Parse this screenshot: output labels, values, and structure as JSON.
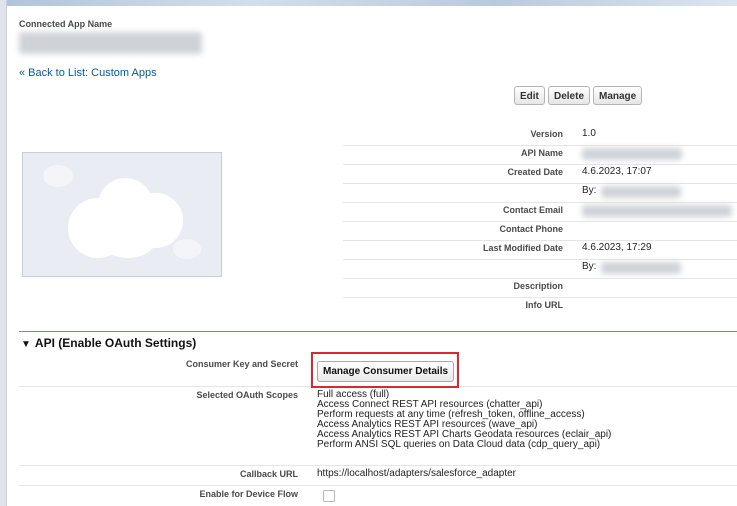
{
  "header": {
    "app_name_label": "Connected App Name",
    "back_link": "« Back to List: Custom Apps"
  },
  "toolbar": {
    "edit_label": "Edit",
    "delete_label": "Delete",
    "manage_label": "Manage"
  },
  "details": {
    "version_label": "Version",
    "version_value": "1.0",
    "api_name_label": "API Name",
    "created_date_label": "Created Date",
    "created_date_value": "4.6.2023, 17:07",
    "created_by_prefix": "By:",
    "contact_email_label": "Contact Email",
    "contact_phone_label": "Contact Phone",
    "last_modified_label": "Last Modified Date",
    "last_modified_value": "4.6.2023, 17:29",
    "modified_by_prefix": "By:",
    "description_label": "Description",
    "info_url_label": "Info URL"
  },
  "api_section": {
    "title": "API (Enable OAuth Settings)",
    "consumer_key_label": "Consumer Key and Secret",
    "manage_consumer_button": "Manage Consumer Details",
    "scopes_label": "Selected OAuth Scopes",
    "scopes": [
      "Full access (full)",
      "Access Connect REST API resources (chatter_api)",
      "Perform requests at any time (refresh_token, offline_access)",
      "Access Analytics REST API resources (wave_api)",
      "Access Analytics REST API Charts Geodata resources (eclair_api)",
      "Perform ANSI SQL queries on Data Cloud data (cdp_query_api)"
    ],
    "callback_url_label": "Callback URL",
    "callback_url_value": "https://localhost/adapters/salesforce_adapter",
    "device_flow_label": "Enable for Device Flow"
  }
}
